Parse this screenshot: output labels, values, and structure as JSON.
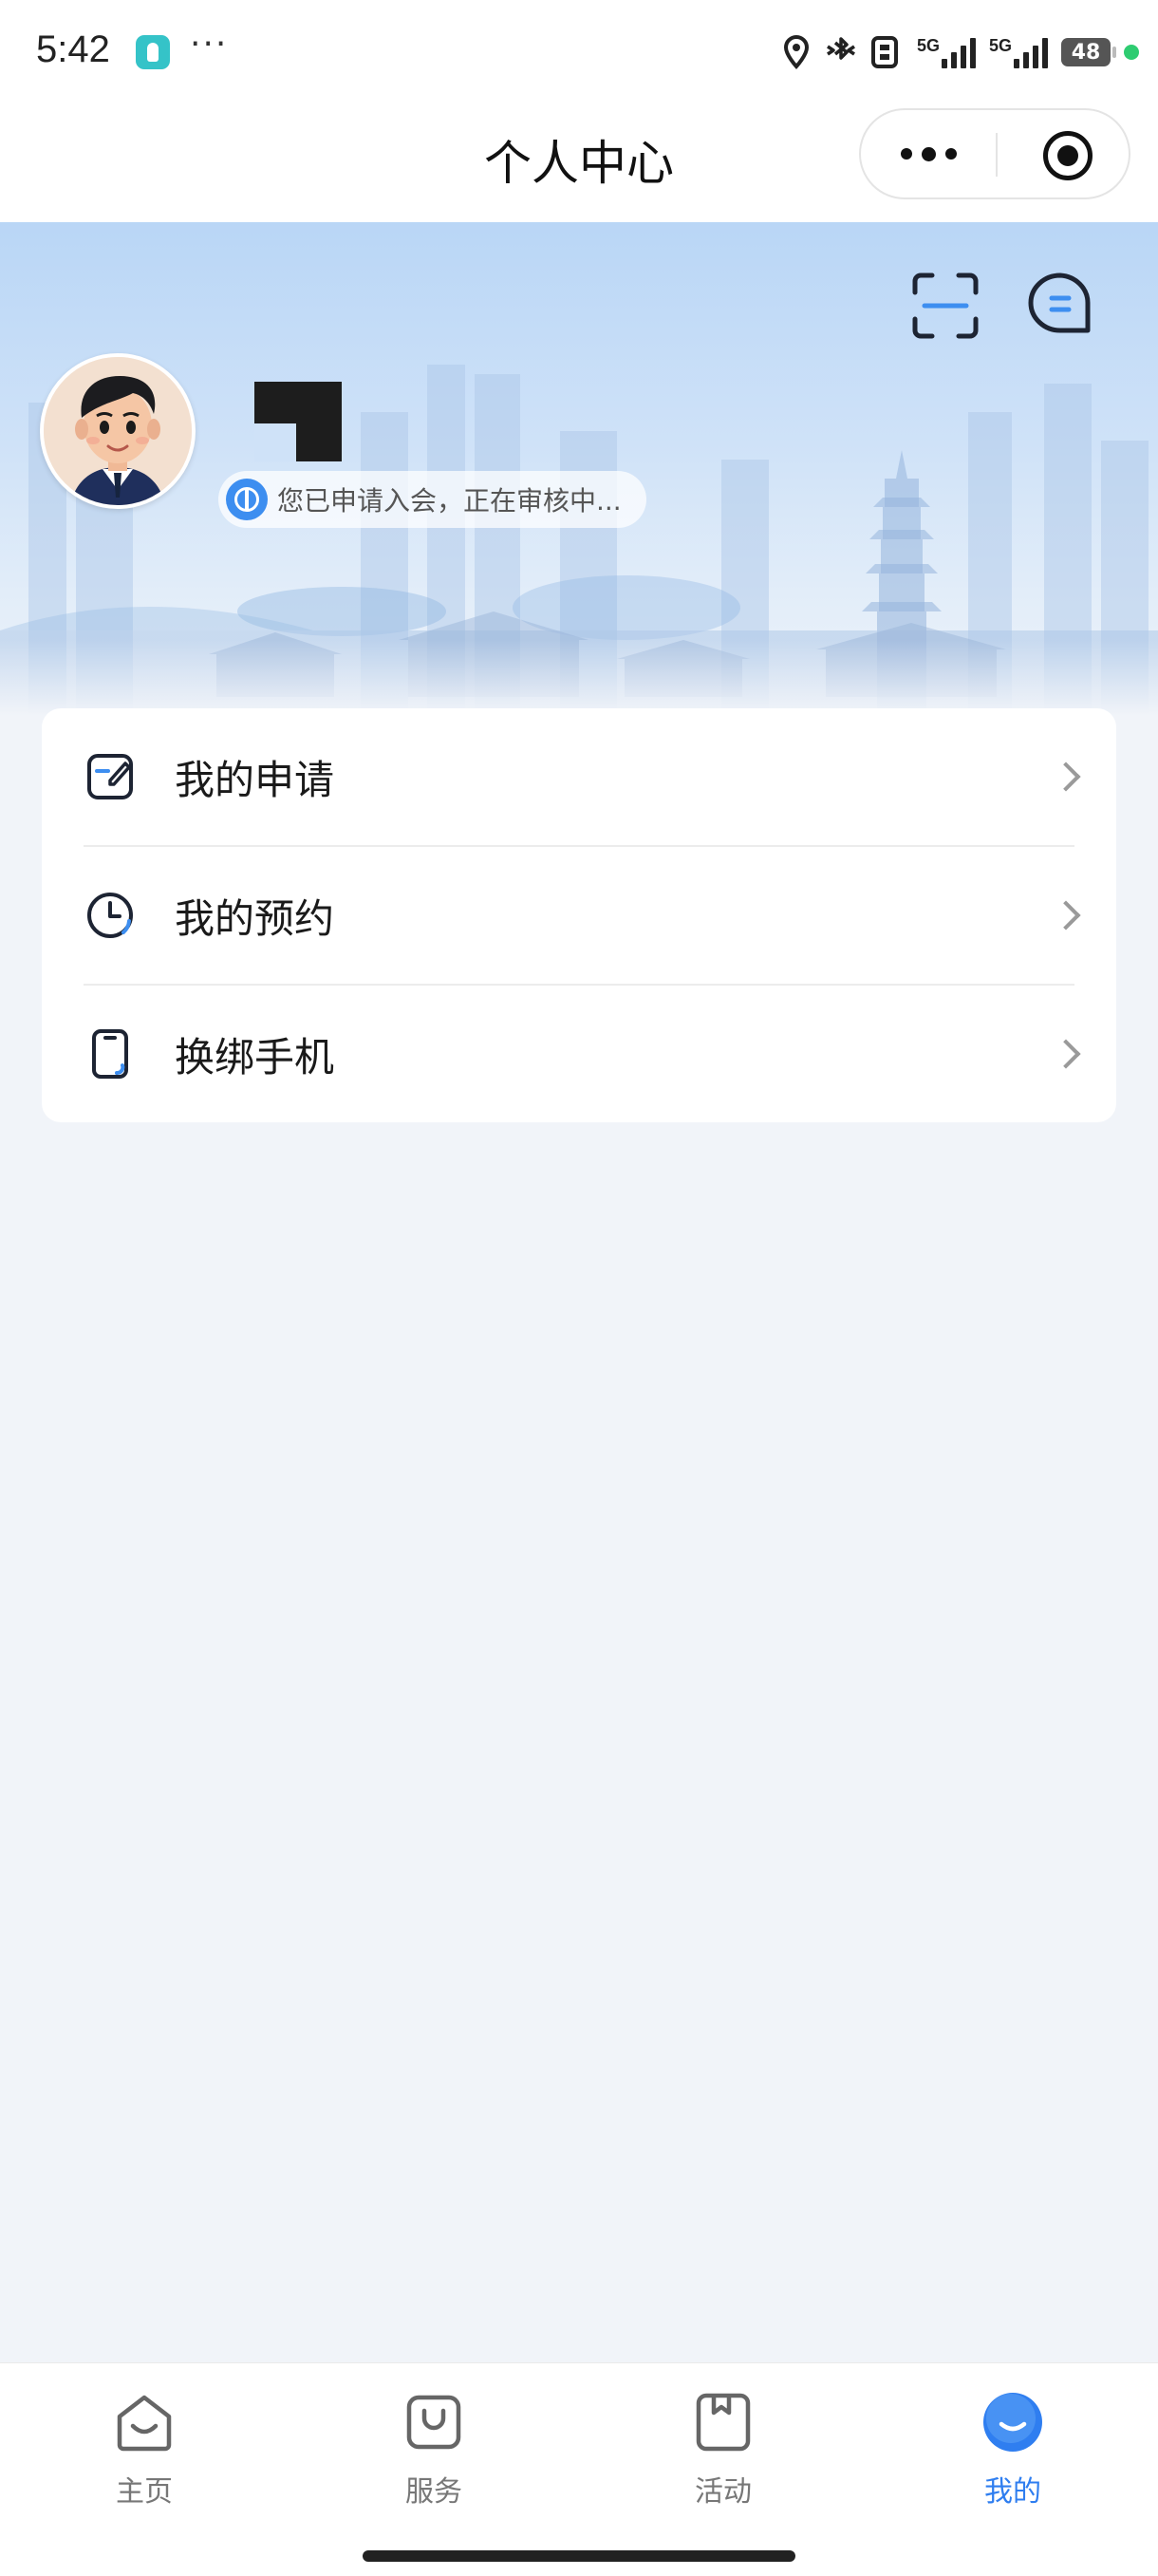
{
  "status_bar": {
    "time": "5:42",
    "more": "···",
    "network_label_1": "5G",
    "network_label_2": "5G",
    "battery": "48"
  },
  "header": {
    "title": "个人中心"
  },
  "profile": {
    "status_text": "您已申请入会，正在审核中..."
  },
  "menu": {
    "items": [
      {
        "label": "我的申请",
        "icon": "edit-icon"
      },
      {
        "label": "我的预约",
        "icon": "clock-icon"
      },
      {
        "label": "换绑手机",
        "icon": "phone-icon"
      }
    ]
  },
  "tab_bar": {
    "active_color": "#2f7ef0",
    "tabs": [
      {
        "label": "主页",
        "icon": "home-icon"
      },
      {
        "label": "服务",
        "icon": "bag-icon"
      },
      {
        "label": "活动",
        "icon": "bookmark-icon"
      },
      {
        "label": "我的",
        "icon": "profile-icon"
      }
    ]
  }
}
